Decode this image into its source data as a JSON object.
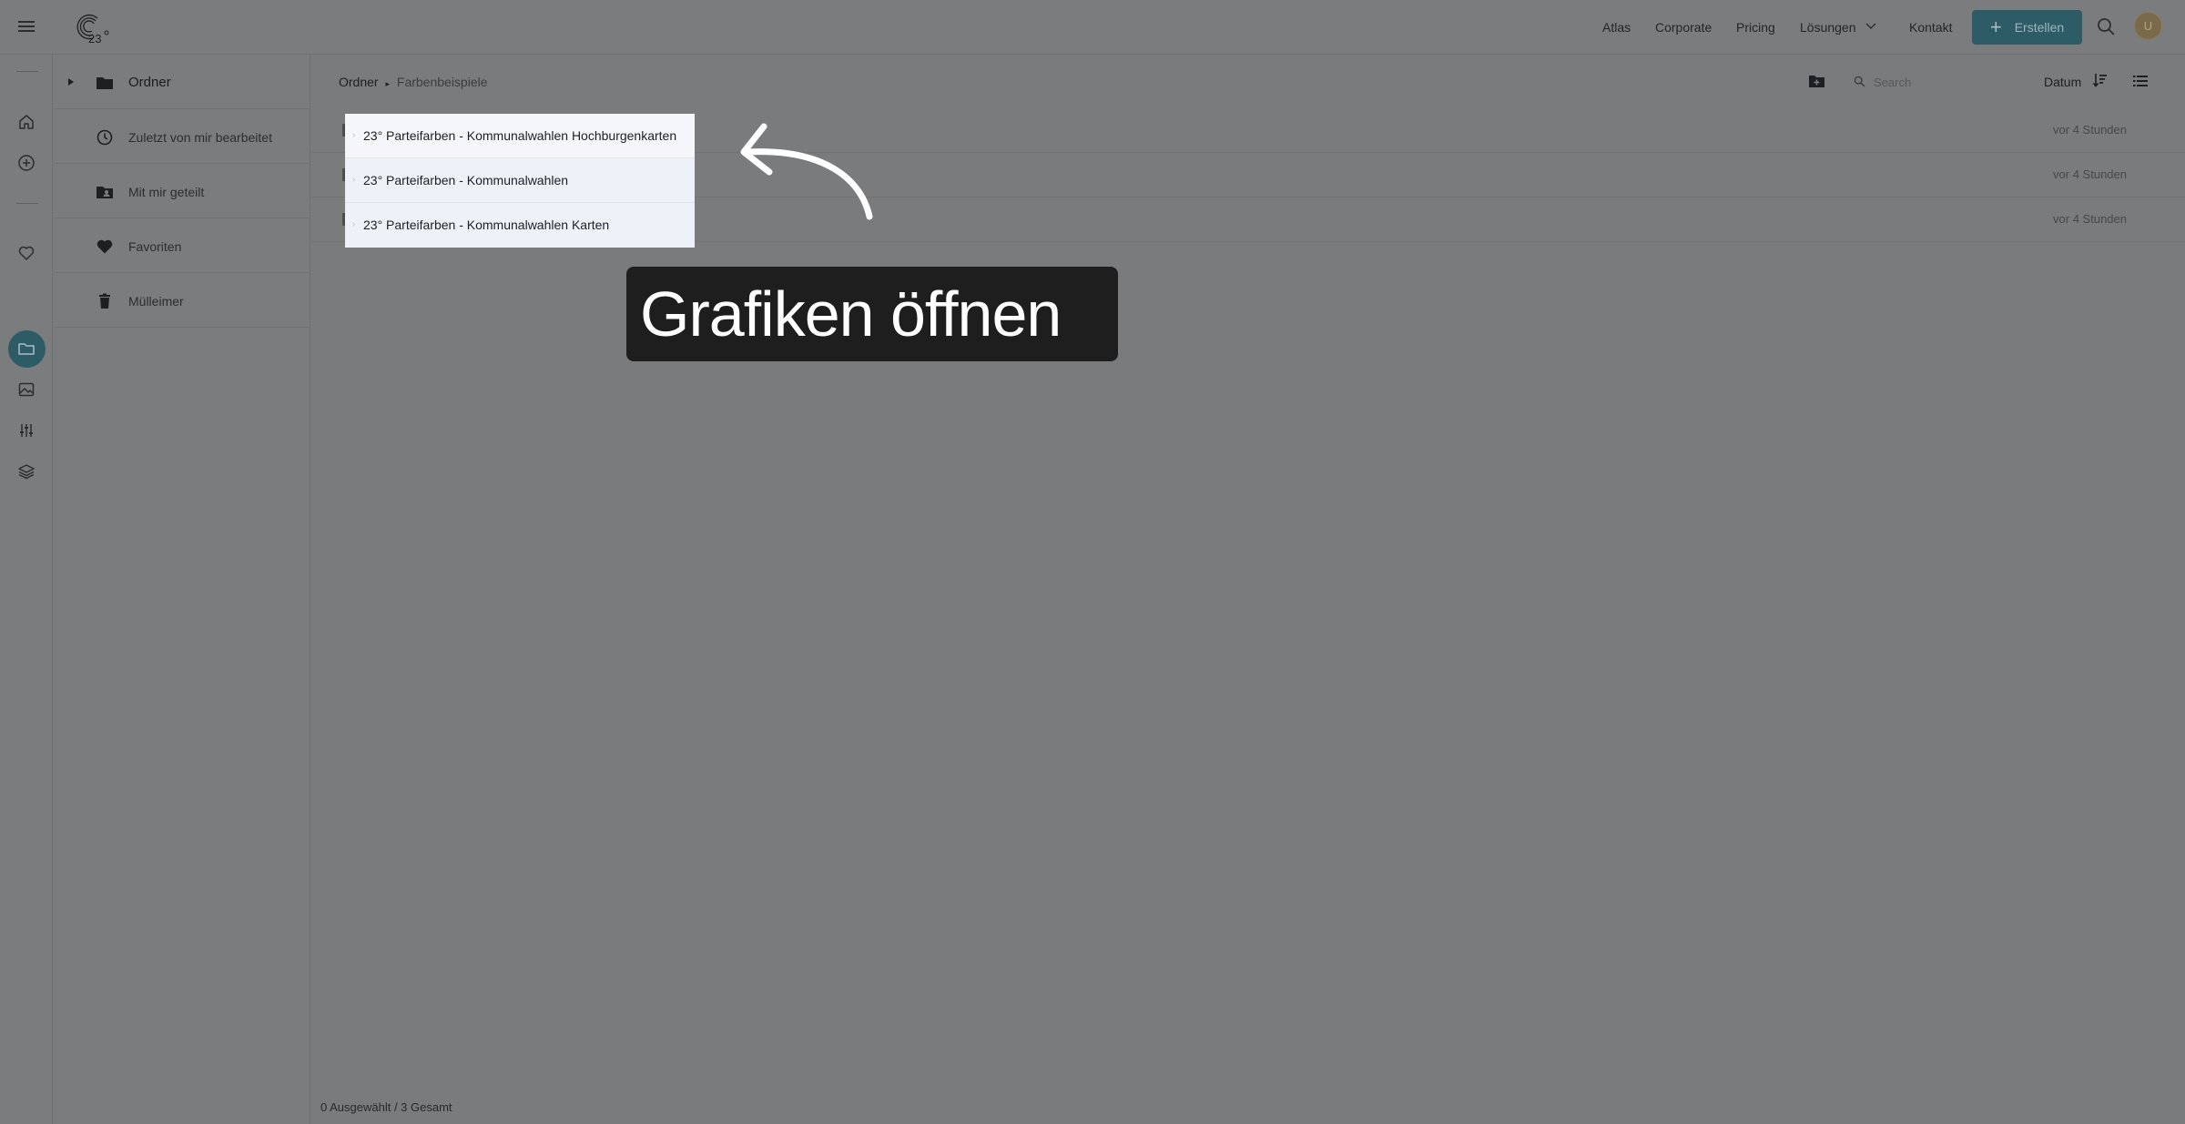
{
  "topbar": {
    "logo_text": "23°",
    "nav": [
      "Atlas",
      "Corporate",
      "Pricing",
      "Lösungen",
      "Kontakt"
    ],
    "create_label": "Erstellen",
    "avatar_initial": "U"
  },
  "sidebar": {
    "items": [
      {
        "label": "Ordner",
        "icon": "folder-icon"
      },
      {
        "label": "Zuletzt von mir bearbeitet",
        "icon": "clock-icon"
      },
      {
        "label": "Mit mir geteilt",
        "icon": "shared-folder-icon"
      },
      {
        "label": "Favoriten",
        "icon": "heart-icon"
      },
      {
        "label": "Mülleimer",
        "icon": "trash-icon"
      }
    ]
  },
  "main": {
    "breadcrumb": {
      "root": "Ordner",
      "separator": "▸",
      "current": "Farbenbeispiele"
    },
    "search_placeholder": "Search",
    "sort_label": "Datum",
    "rows": [
      {
        "name": "23° Parteifarben - Kommunalwahlen Hochburgenkarten",
        "time": "vor 4 Stunden"
      },
      {
        "name": "23° Parteifarben - Kommunalwahlen",
        "time": "vor 4 Stunden"
      },
      {
        "name": "23° Parteifarben - Kommunalwahlen Karten",
        "time": "vor 4 Stunden"
      }
    ],
    "status": "0 Ausgewählt / 3 Gesamt"
  },
  "callout": {
    "text": "Grafiken öffnen"
  },
  "colors": {
    "accent": "#2d5c66",
    "overlay": "#7a7b7d",
    "callout_bg": "#1e1e1e",
    "popup_bg": "#eef1f7"
  }
}
